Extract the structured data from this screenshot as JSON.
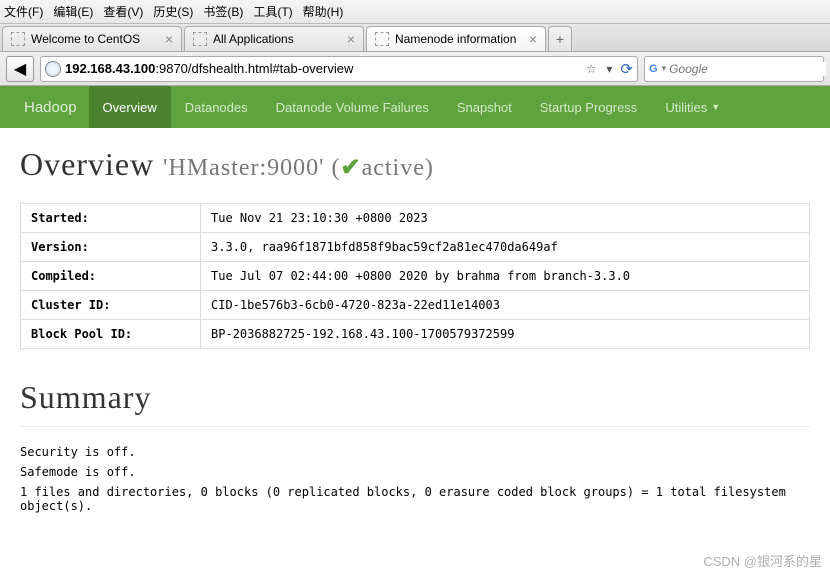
{
  "os_menu": [
    "文件(F)",
    "编辑(E)",
    "查看(V)",
    "历史(S)",
    "书签(B)",
    "工具(T)",
    "帮助(H)"
  ],
  "tabs": [
    {
      "title": "Welcome to CentOS",
      "active": false
    },
    {
      "title": "All Applications",
      "active": false
    },
    {
      "title": "Namenode information",
      "active": true
    }
  ],
  "url": {
    "host": "192.168.43.100",
    "rest": ":9870/dfshealth.html#tab-overview"
  },
  "search": {
    "placeholder": "Google"
  },
  "hadoop_nav": {
    "brand": "Hadoop",
    "items": [
      "Overview",
      "Datanodes",
      "Datanode Volume Failures",
      "Snapshot",
      "Startup Progress",
      "Utilities"
    ],
    "active": "Overview",
    "dropdown": "Utilities"
  },
  "overview": {
    "title": "Overview",
    "host_label": "'HMaster:9000'",
    "status": "active"
  },
  "info_rows": [
    {
      "label": "Started:",
      "value": "Tue Nov 21 23:10:30 +0800 2023"
    },
    {
      "label": "Version:",
      "value": "3.3.0, raa96f1871bfd858f9bac59cf2a81ec470da649af"
    },
    {
      "label": "Compiled:",
      "value": "Tue Jul 07 02:44:00 +0800 2020 by brahma from branch-3.3.0"
    },
    {
      "label": "Cluster ID:",
      "value": "CID-1be576b3-6cb0-4720-823a-22ed11e14003"
    },
    {
      "label": "Block Pool ID:",
      "value": "BP-2036882725-192.168.43.100-1700579372599"
    }
  ],
  "summary": {
    "title": "Summary",
    "lines": [
      "Security is off.",
      "Safemode is off.",
      "1 files and directories, 0 blocks (0 replicated blocks, 0 erasure coded block groups) = 1 total filesystem object(s)."
    ]
  },
  "watermark": "CSDN @银河系的星"
}
